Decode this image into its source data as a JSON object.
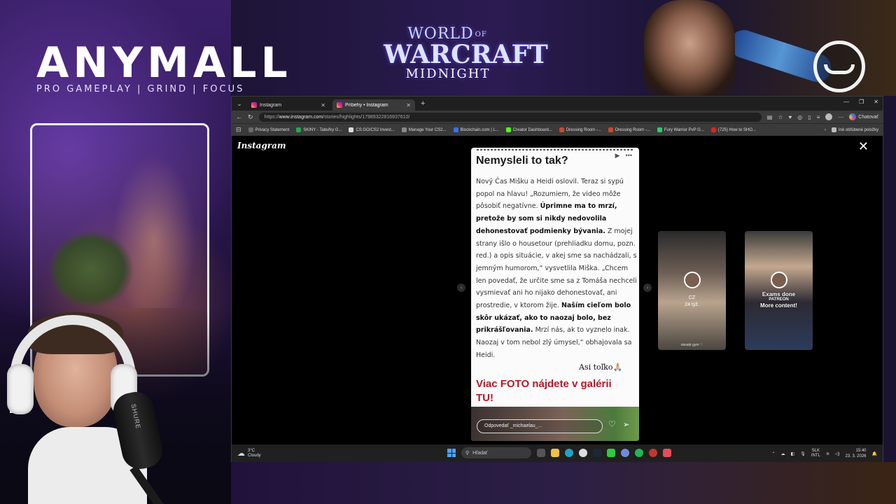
{
  "overlay": {
    "brand_name": "ANYMALL",
    "brand_tagline": "PRO GAMEPLAY | GRIND | FOCUS",
    "game_logo_top_left": "WORLD",
    "game_logo_top_of": "OF",
    "game_logo_mid": "WARCRAFT",
    "game_logo_bottom": "MIDNIGHT",
    "mic_brand": "SHURE"
  },
  "browser": {
    "tabs": [
      {
        "title": "Instagram",
        "active": false
      },
      {
        "title": "Príbehy • Instagram",
        "active": true
      }
    ],
    "url_scheme": "https://",
    "url_host": "www.instagram.com",
    "url_path": "/stories/highlights/17989322816937610/",
    "copilot_label": "Chatovať",
    "bookmarks": [
      "Privacy Statement",
      "SKINY - Tabuľky G...",
      "CS:GO/CS2 Invest...",
      "Manage Your CS2...",
      "Blockchain.com | L...",
      "Creator Dashboard...",
      "Dressing Room -...",
      "Dressing Room -...",
      "Fury Warrior PvP G...",
      "(725) How to SHO..."
    ],
    "bookmarks_other": "Iné obľúbené položky"
  },
  "instagram": {
    "logo": "Instagram",
    "story": {
      "heading": "Nemysleli to tak?",
      "p1": "Nový Čas Mišku a Heidi oslovil. Teraz si sypú popol na hlavu! „Rozumiem, že video môže pôsobiť negatívne. ",
      "p1_bold": "Úprimne ma to mrzí, pretože by som si nikdy nedovolila dehonestovať podmienky bývania.",
      "p2": " Z mojej strany išlo o housetour (prehliadku domu, pozn. red.) a opis situácie, v akej sme sa nachádzali, s jemným humorom,“ vysvetlila Miška. „Chcem len povedať, že určite sme sa z Tomáša nechceli vysmievať ani ho nijako dehonestovať, ani prostredie, v ktorom žije. ",
      "p2_bold": "Naším cieľom bolo skôr ukázať, ako to naozaj bolo, bez prikrášľovania.",
      "p3": " Mrzí nás, ak to vyznelo inak. Naozaj v tom nebol zlý úmysel,“ obhajovala sa Heidi.",
      "sticker": "Asi toľko🙏🏼",
      "link_text": "Viac FOTO nájdete v galérii TU!",
      "reply_placeholder": "Odpovedať _michaelau_..."
    },
    "next_stories": [
      {
        "overlay_line1": "CZ",
        "overlay_line2": "24 týž.",
        "caption": "návaté gym ♡"
      },
      {
        "overlay_line1": "Exams done",
        "overlay_line2": "PATREON",
        "overlay_line3": "More content!"
      }
    ]
  },
  "taskbar": {
    "weather_temp": "3°C",
    "weather_desc": "Cloudy",
    "search_placeholder": "Hľadať",
    "lang_top": "SLK",
    "lang_bottom": "INTL",
    "time": "15:40",
    "date": "23. 3. 2026"
  },
  "colors": {
    "story_link": "#b5172b",
    "taskbar_bg": "#202020",
    "browser_chrome": "#3a3a3a"
  }
}
